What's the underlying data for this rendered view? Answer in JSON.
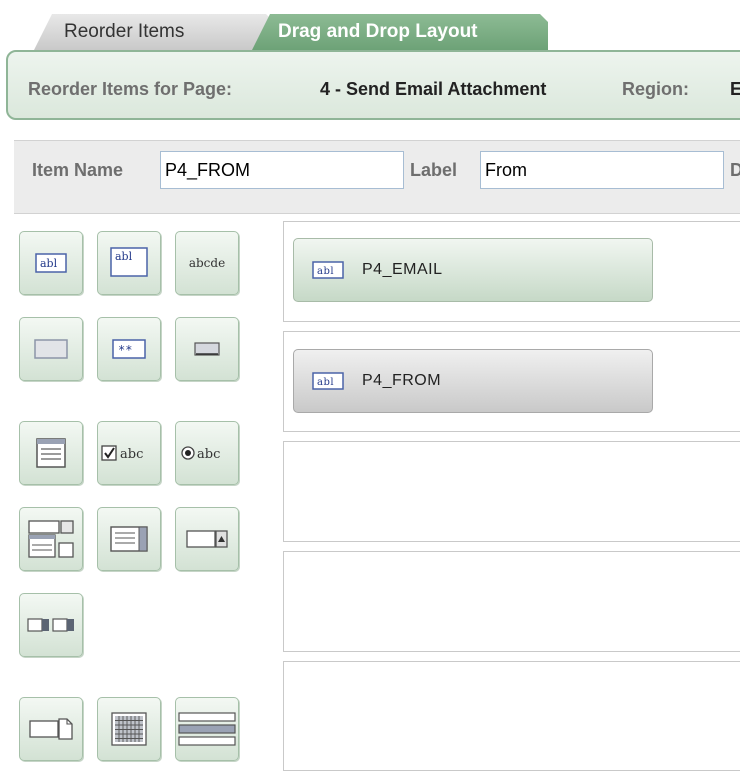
{
  "tabs": [
    {
      "label": "Reorder Items",
      "active": false
    },
    {
      "label": "Drag and Drop Layout",
      "active": true
    }
  ],
  "header": {
    "page_label": "Reorder Items for Page:",
    "page_value": "4 - Send Email Attachment",
    "region_label": "Region:",
    "region_value": "E"
  },
  "item_props": {
    "item_name_label": "Item Name",
    "item_name_value": "P4_FROM",
    "label_label": "Label",
    "label_value": "From",
    "next_label": "D"
  },
  "palette": [
    {
      "icon": "text-field-icon",
      "text": "abl"
    },
    {
      "icon": "textarea-icon",
      "text": "abl"
    },
    {
      "icon": "display-only-icon",
      "text": "abcde"
    },
    {
      "icon": "hidden-item-icon"
    },
    {
      "icon": "password-icon",
      "text": "**"
    },
    {
      "icon": "button-icon"
    },
    {
      "icon": "list-icon"
    },
    {
      "icon": "checkbox-icon",
      "text": "abc"
    },
    {
      "icon": "radio-group-icon",
      "text": "abc"
    },
    {
      "icon": "shuttle-icon"
    },
    {
      "icon": "select-list-icon"
    },
    {
      "icon": "popup-lov-icon"
    },
    {
      "icon": "date-picker-icon"
    },
    {
      "icon": "file-browse-icon"
    },
    {
      "icon": "calendar-grid-icon"
    },
    {
      "icon": "stop-start-icon"
    }
  ],
  "layout_items": [
    {
      "name": "P4_EMAIL",
      "icon_text": "abl",
      "selected": false
    },
    {
      "name": "P4_FROM",
      "icon_text": "abl",
      "selected": true
    }
  ],
  "colors": {
    "active_tab": "#76a87f",
    "header_border": "#8fb597",
    "chip_green": "#c6d9c7",
    "chip_selected": "#c9c9c9"
  }
}
